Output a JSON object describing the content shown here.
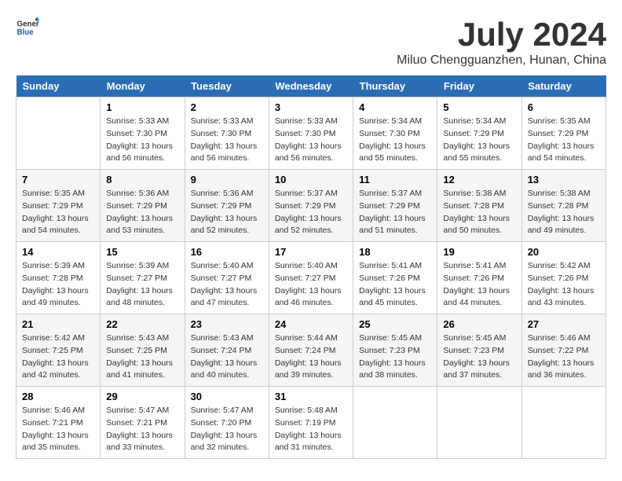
{
  "logo": {
    "general": "General",
    "blue": "Blue"
  },
  "header": {
    "month_year": "July 2024",
    "location": "Miluo Chengguanzhen, Hunan, China"
  },
  "weekdays": [
    "Sunday",
    "Monday",
    "Tuesday",
    "Wednesday",
    "Thursday",
    "Friday",
    "Saturday"
  ],
  "weeks": [
    [
      {
        "day": "",
        "sunrise": "",
        "sunset": "",
        "daylight": ""
      },
      {
        "day": "1",
        "sunrise": "Sunrise: 5:33 AM",
        "sunset": "Sunset: 7:30 PM",
        "daylight": "Daylight: 13 hours and 56 minutes."
      },
      {
        "day": "2",
        "sunrise": "Sunrise: 5:33 AM",
        "sunset": "Sunset: 7:30 PM",
        "daylight": "Daylight: 13 hours and 56 minutes."
      },
      {
        "day": "3",
        "sunrise": "Sunrise: 5:33 AM",
        "sunset": "Sunset: 7:30 PM",
        "daylight": "Daylight: 13 hours and 56 minutes."
      },
      {
        "day": "4",
        "sunrise": "Sunrise: 5:34 AM",
        "sunset": "Sunset: 7:30 PM",
        "daylight": "Daylight: 13 hours and 55 minutes."
      },
      {
        "day": "5",
        "sunrise": "Sunrise: 5:34 AM",
        "sunset": "Sunset: 7:29 PM",
        "daylight": "Daylight: 13 hours and 55 minutes."
      },
      {
        "day": "6",
        "sunrise": "Sunrise: 5:35 AM",
        "sunset": "Sunset: 7:29 PM",
        "daylight": "Daylight: 13 hours and 54 minutes."
      }
    ],
    [
      {
        "day": "7",
        "sunrise": "Sunrise: 5:35 AM",
        "sunset": "Sunset: 7:29 PM",
        "daylight": "Daylight: 13 hours and 54 minutes."
      },
      {
        "day": "8",
        "sunrise": "Sunrise: 5:36 AM",
        "sunset": "Sunset: 7:29 PM",
        "daylight": "Daylight: 13 hours and 53 minutes."
      },
      {
        "day": "9",
        "sunrise": "Sunrise: 5:36 AM",
        "sunset": "Sunset: 7:29 PM",
        "daylight": "Daylight: 13 hours and 52 minutes."
      },
      {
        "day": "10",
        "sunrise": "Sunrise: 5:37 AM",
        "sunset": "Sunset: 7:29 PM",
        "daylight": "Daylight: 13 hours and 52 minutes."
      },
      {
        "day": "11",
        "sunrise": "Sunrise: 5:37 AM",
        "sunset": "Sunset: 7:29 PM",
        "daylight": "Daylight: 13 hours and 51 minutes."
      },
      {
        "day": "12",
        "sunrise": "Sunrise: 5:38 AM",
        "sunset": "Sunset: 7:28 PM",
        "daylight": "Daylight: 13 hours and 50 minutes."
      },
      {
        "day": "13",
        "sunrise": "Sunrise: 5:38 AM",
        "sunset": "Sunset: 7:28 PM",
        "daylight": "Daylight: 13 hours and 49 minutes."
      }
    ],
    [
      {
        "day": "14",
        "sunrise": "Sunrise: 5:39 AM",
        "sunset": "Sunset: 7:28 PM",
        "daylight": "Daylight: 13 hours and 49 minutes."
      },
      {
        "day": "15",
        "sunrise": "Sunrise: 5:39 AM",
        "sunset": "Sunset: 7:27 PM",
        "daylight": "Daylight: 13 hours and 48 minutes."
      },
      {
        "day": "16",
        "sunrise": "Sunrise: 5:40 AM",
        "sunset": "Sunset: 7:27 PM",
        "daylight": "Daylight: 13 hours and 47 minutes."
      },
      {
        "day": "17",
        "sunrise": "Sunrise: 5:40 AM",
        "sunset": "Sunset: 7:27 PM",
        "daylight": "Daylight: 13 hours and 46 minutes."
      },
      {
        "day": "18",
        "sunrise": "Sunrise: 5:41 AM",
        "sunset": "Sunset: 7:26 PM",
        "daylight": "Daylight: 13 hours and 45 minutes."
      },
      {
        "day": "19",
        "sunrise": "Sunrise: 5:41 AM",
        "sunset": "Sunset: 7:26 PM",
        "daylight": "Daylight: 13 hours and 44 minutes."
      },
      {
        "day": "20",
        "sunrise": "Sunrise: 5:42 AM",
        "sunset": "Sunset: 7:26 PM",
        "daylight": "Daylight: 13 hours and 43 minutes."
      }
    ],
    [
      {
        "day": "21",
        "sunrise": "Sunrise: 5:42 AM",
        "sunset": "Sunset: 7:25 PM",
        "daylight": "Daylight: 13 hours and 42 minutes."
      },
      {
        "day": "22",
        "sunrise": "Sunrise: 5:43 AM",
        "sunset": "Sunset: 7:25 PM",
        "daylight": "Daylight: 13 hours and 41 minutes."
      },
      {
        "day": "23",
        "sunrise": "Sunrise: 5:43 AM",
        "sunset": "Sunset: 7:24 PM",
        "daylight": "Daylight: 13 hours and 40 minutes."
      },
      {
        "day": "24",
        "sunrise": "Sunrise: 5:44 AM",
        "sunset": "Sunset: 7:24 PM",
        "daylight": "Daylight: 13 hours and 39 minutes."
      },
      {
        "day": "25",
        "sunrise": "Sunrise: 5:45 AM",
        "sunset": "Sunset: 7:23 PM",
        "daylight": "Daylight: 13 hours and 38 minutes."
      },
      {
        "day": "26",
        "sunrise": "Sunrise: 5:45 AM",
        "sunset": "Sunset: 7:23 PM",
        "daylight": "Daylight: 13 hours and 37 minutes."
      },
      {
        "day": "27",
        "sunrise": "Sunrise: 5:46 AM",
        "sunset": "Sunset: 7:22 PM",
        "daylight": "Daylight: 13 hours and 36 minutes."
      }
    ],
    [
      {
        "day": "28",
        "sunrise": "Sunrise: 5:46 AM",
        "sunset": "Sunset: 7:21 PM",
        "daylight": "Daylight: 13 hours and 35 minutes."
      },
      {
        "day": "29",
        "sunrise": "Sunrise: 5:47 AM",
        "sunset": "Sunset: 7:21 PM",
        "daylight": "Daylight: 13 hours and 33 minutes."
      },
      {
        "day": "30",
        "sunrise": "Sunrise: 5:47 AM",
        "sunset": "Sunset: 7:20 PM",
        "daylight": "Daylight: 13 hours and 32 minutes."
      },
      {
        "day": "31",
        "sunrise": "Sunrise: 5:48 AM",
        "sunset": "Sunset: 7:19 PM",
        "daylight": "Daylight: 13 hours and 31 minutes."
      },
      {
        "day": "",
        "sunrise": "",
        "sunset": "",
        "daylight": ""
      },
      {
        "day": "",
        "sunrise": "",
        "sunset": "",
        "daylight": ""
      },
      {
        "day": "",
        "sunrise": "",
        "sunset": "",
        "daylight": ""
      }
    ]
  ]
}
